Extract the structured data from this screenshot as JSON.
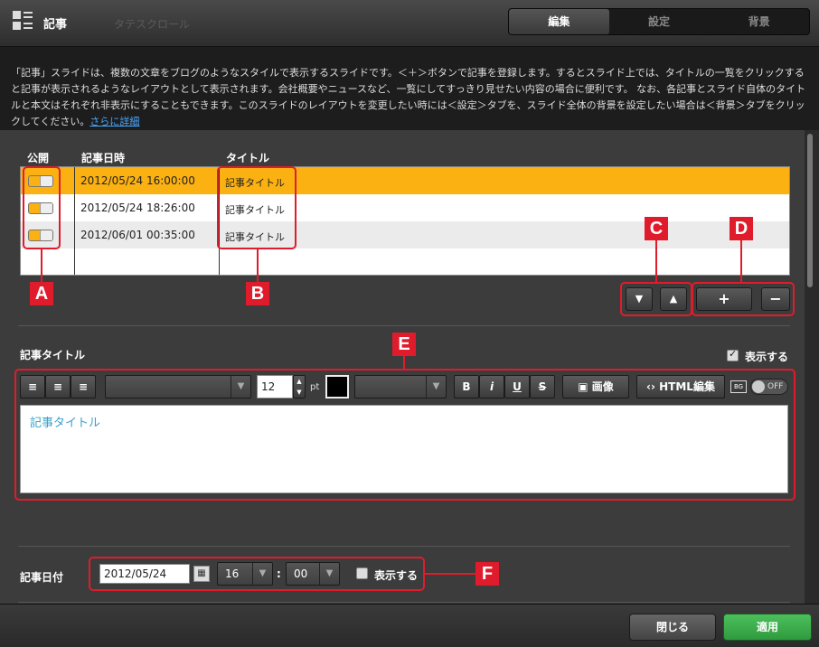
{
  "header": {
    "title": "記事",
    "ghost_text": "タテスクロール",
    "tabs": [
      {
        "label": "編集",
        "active": true
      },
      {
        "label": "設定",
        "active": false
      },
      {
        "label": "背景",
        "active": false
      }
    ]
  },
  "description": {
    "line1": "「記事」スライドは、複数の文章をブログのようなスタイルで表示するスライドです。＜＋＞ボタンで記事を登録します。するとスライド上では、タイトルの一覧をクリックすると記事が表示されるようなレイアウトとして表示されます。会社概要やニュースなど、一覧にしてすっきり見せたい内容の場合に便利です。 なお、各記事とスライド自体のタイトルと本文はそれぞれ非表示にすることもできます。このスライドのレイアウトを変更したい時には＜設定＞タブを、スライド全体の背景を設定したい場合は＜背景＞タブをクリックしてください。",
    "link": "さらに詳細"
  },
  "table": {
    "columns": [
      "公開",
      "記事日時",
      "タイトル"
    ],
    "rows": [
      {
        "published": true,
        "date": "2012/05/24 16:00:00",
        "title": "記事タイトル",
        "selected": true
      },
      {
        "published": true,
        "date": "2012/05/24 18:26:00",
        "title": "記事タイトル",
        "selected": false
      },
      {
        "published": true,
        "date": "2012/06/01 00:35:00",
        "title": "記事タイトル",
        "selected": false
      }
    ]
  },
  "callouts": {
    "a": "A",
    "b": "B",
    "c": "C",
    "d": "D",
    "e": "E",
    "f": "F"
  },
  "article_title": {
    "label": "記事タイトル",
    "show_label": "表示する",
    "show_checked": true,
    "font_size": "12",
    "size_unit": "pt",
    "image_button": "画像",
    "html_button": "HTML編集",
    "bg_label": "BG",
    "bg_toggle": "OFF",
    "content": "記事タイトル"
  },
  "article_date": {
    "label": "記事日付",
    "date": "2012/05/24",
    "hour": "16",
    "separator": ":",
    "minute": "00",
    "show_label": "表示する",
    "show_checked": false
  },
  "footer": {
    "close": "閉じる",
    "apply": "適用"
  },
  "colors": {
    "accent": "#fbb112",
    "callout": "#e01c2c",
    "apply": "#3aa84a"
  }
}
